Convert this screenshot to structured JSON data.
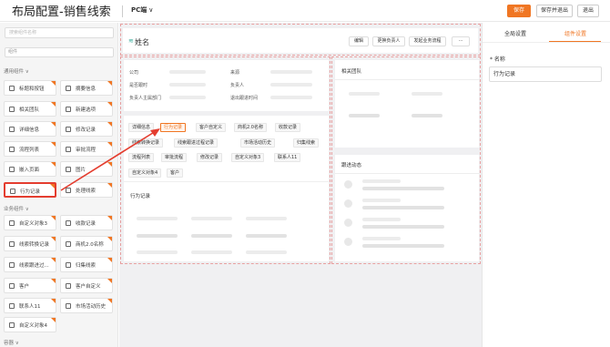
{
  "header": {
    "title": "布局配置-销售线索",
    "device": "PC端",
    "save": "保存",
    "save_exit": "保存并退出",
    "exit": "退出"
  },
  "left": {
    "search_placeholder": "搜索组件名称",
    "filter": "组件",
    "group_general": "通用组件 ∨",
    "group_business": "业务组件 ∨",
    "group_more": "容器 ∨",
    "general_items": [
      "标题和按钮",
      "摘要信息",
      "相关团队",
      "新建选项",
      "详细信息",
      "修改记录",
      "流程列表",
      "审批流程",
      "嵌入页面",
      "图片",
      "行为记录",
      "处理线索"
    ],
    "business_items": [
      "自定义对象3",
      "收款记录",
      "线索转换记录",
      "商机2.0名称",
      "线索跟进过...",
      "归集线索",
      "客户",
      "客户自定义",
      "联系人11",
      "市场活动历史",
      "自定义对象4"
    ]
  },
  "canvas": {
    "record_name": "姓名",
    "header_buttons": [
      "编辑",
      "更换负责人",
      "发起业务流程",
      "···"
    ],
    "fields": [
      "公司",
      "来源",
      "是否跟时",
      "负责人",
      "负责人主属部门",
      "退出跟进时间"
    ],
    "tabs": [
      "详细信息",
      "行为记录",
      "客户自定义",
      "商机2.0名称",
      "收款记录",
      "线索转换记录",
      "线索跟进过程记录",
      "市场活动历史",
      "归集线索",
      "流程列表",
      "审批流程",
      "修改记录",
      "自定义对象3",
      "联系人11",
      "自定义对象4",
      "客户"
    ],
    "active_tab": "行为记录",
    "tab_section_title": "行为记录",
    "related_team": "相关团队",
    "follow_up": "跟进动态"
  },
  "right": {
    "tab_global": "全局设置",
    "tab_component": "组件设置",
    "name_label": "* 名称",
    "name_value": "行为记录"
  },
  "colors": {
    "accent": "#f07623",
    "highlight": "#e43d2f",
    "dashed": "#e8a0a0"
  }
}
